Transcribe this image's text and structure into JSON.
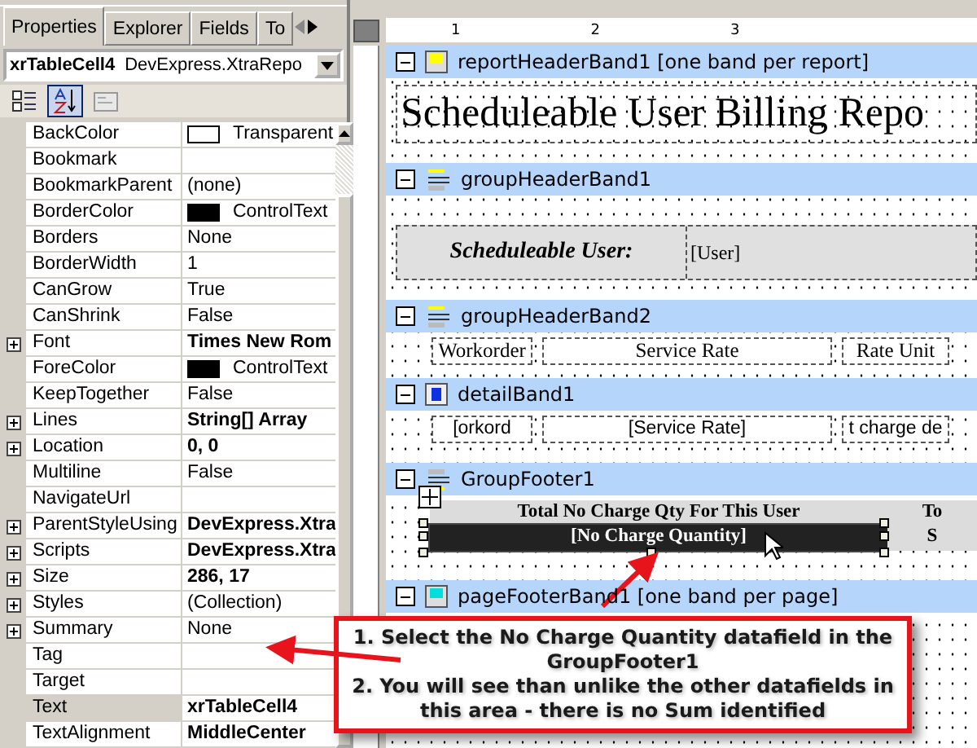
{
  "properties_panel": {
    "tabs": [
      {
        "label": "Properties",
        "selected": true
      },
      {
        "label": "Explorer",
        "selected": false
      },
      {
        "label": "Fields",
        "selected": false
      },
      {
        "label": "To",
        "selected": false
      }
    ],
    "object_name": "xrTableCell4",
    "object_type": "DevExpress.XtraRepo",
    "sort_buttons": [
      {
        "kind": "categorized",
        "selected": false
      },
      {
        "kind": "alphabetical",
        "selected": true
      },
      {
        "kind": "pages",
        "selected": false
      }
    ],
    "rows": [
      {
        "name": "BackColor",
        "value": "Transparent",
        "color": "#ffffff",
        "expandable": false,
        "bold": false,
        "selected": false
      },
      {
        "name": "Bookmark",
        "expandable": false,
        "bold": false,
        "selected": false
      },
      {
        "name": "BookmarkParent",
        "value": "(none)",
        "expandable": false,
        "bold": false,
        "selected": false
      },
      {
        "name": "BorderColor",
        "value": "ControlText",
        "color": "#000000",
        "expandable": false,
        "bold": false,
        "selected": false
      },
      {
        "name": "Borders",
        "value": "None",
        "expandable": false,
        "bold": false,
        "selected": false
      },
      {
        "name": "BorderWidth",
        "value": "1",
        "expandable": false,
        "bold": false,
        "selected": false
      },
      {
        "name": "CanGrow",
        "value": "True",
        "expandable": false,
        "bold": false,
        "selected": false
      },
      {
        "name": "CanShrink",
        "value": "False",
        "expandable": false,
        "bold": false,
        "selected": false
      },
      {
        "name": "Font",
        "value": "Times New Rom",
        "expandable": true,
        "bold": true,
        "selected": false
      },
      {
        "name": "ForeColor",
        "value": "ControlText",
        "color": "#000000",
        "expandable": false,
        "bold": false,
        "selected": false
      },
      {
        "name": "KeepTogether",
        "value": "False",
        "expandable": false,
        "bold": false,
        "selected": false
      },
      {
        "name": "Lines",
        "value": "String[] Array",
        "expandable": true,
        "bold": true,
        "selected": false
      },
      {
        "name": "Location",
        "value": "0, 0",
        "expandable": true,
        "bold": true,
        "selected": false
      },
      {
        "name": "Multiline",
        "value": "False",
        "expandable": false,
        "bold": false,
        "selected": false
      },
      {
        "name": "NavigateUrl",
        "expandable": false,
        "bold": false,
        "selected": false
      },
      {
        "name": "ParentStyleUsing",
        "value": "DevExpress.Xtra",
        "expandable": true,
        "bold": true,
        "selected": false
      },
      {
        "name": "Scripts",
        "value": "DevExpress.Xtra",
        "expandable": true,
        "bold": true,
        "selected": false
      },
      {
        "name": "Size",
        "value": "286, 17",
        "expandable": true,
        "bold": true,
        "selected": false
      },
      {
        "name": "Styles",
        "value": "(Collection)",
        "expandable": true,
        "bold": false,
        "selected": false
      },
      {
        "name": "Summary",
        "value": "None",
        "expandable": true,
        "bold": false,
        "selected": false
      },
      {
        "name": "Tag",
        "expandable": false,
        "bold": false,
        "selected": false
      },
      {
        "name": "Target",
        "expandable": false,
        "bold": false,
        "selected": false
      },
      {
        "name": "Text",
        "value": "xrTableCell4",
        "expandable": false,
        "bold": true,
        "selected": true
      },
      {
        "name": "TextAlignment",
        "value": "MiddleCenter",
        "expandable": false,
        "bold": true,
        "selected": false
      }
    ]
  },
  "ruler": [
    "1",
    "2",
    "3"
  ],
  "bands": [
    {
      "kind": "report_header",
      "title": "reportHeaderBand1 [one band per report]",
      "report_title": "Scheduleable User Billing Repo"
    },
    {
      "kind": "group_header",
      "title": "groupHeaderBand1",
      "label": "Scheduleable User:",
      "field": "[User]"
    },
    {
      "kind": "group_header",
      "title": "groupHeaderBand2",
      "columns": [
        "Workorder",
        "Service Rate",
        "Rate Unit"
      ]
    },
    {
      "kind": "detail",
      "title": "detailBand1",
      "columns": [
        "[orkord",
        "[Service Rate]",
        "t charge de"
      ]
    },
    {
      "kind": "group_footer",
      "title": "GroupFooter1",
      "total_label": "Total No Charge Qty For This User",
      "total_label_2": "To",
      "field": "[No Charge Quantity]",
      "field_2": "S",
      "selected": true
    },
    {
      "kind": "page_footer",
      "title": "pageFooterBand1 [one band per page]"
    }
  ],
  "callout": {
    "lines": [
      "1. Select the No Charge Quantity datafield in the GroupFooter1",
      "2. You will see than unlike the other datafields in this area - there is no Sum identified"
    ]
  }
}
